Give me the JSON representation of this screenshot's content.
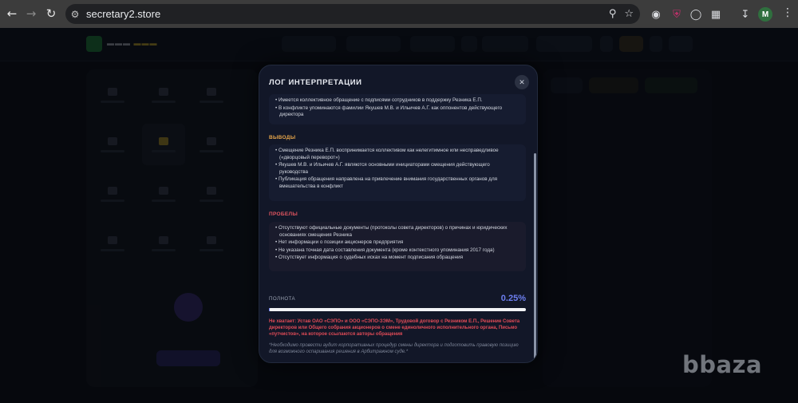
{
  "browser": {
    "url": "secretary2.store",
    "avatar_letter": "M",
    "icons": [
      "back-arrow-icon",
      "forward-arrow-icon",
      "reload-icon",
      "site-settings-icon",
      "zoom-icon",
      "star-icon",
      "incognito-icon",
      "shield-icon",
      "globe-icon",
      "puzzle-icon",
      "download-icon",
      "kebab-menu-icon"
    ]
  },
  "modal": {
    "title": "ЛОГ ИНТЕРПРЕТАЦИИ",
    "facts": [
      "• Имеется коллективное обращение с подписями сотрудников в поддержку Резника Е.П.",
      "• В конфликте упоминаются фамилии Якушев М.В. и Ильичев А.Г. как оппонентов действующего директора"
    ],
    "conclusions": {
      "label": "ВЫВОДЫ",
      "items": [
        "• Смещение Резника Е.П. воспринимается коллективом как нелегитимное или несправедливое («дворцовый переворот»)",
        "• Якушев М.В. и Ильичев А.Г. являются основными инициаторами смещения действующего руководства",
        "• Публикация обращения направлена на привлечение внимания государственных органов для вмешательства в конфликт"
      ]
    },
    "gaps": {
      "label": "ПРОБЕЛЫ",
      "items": [
        "• Отсутствуют официальные документы (протоколы совета директоров) о причинах и юридических основаниях смещения Резника",
        "• Нет информации о позиции акционеров предприятия",
        "• Не указана точная дата составления документа (кроме контекстного упоминания 2017 года)",
        "• Отсутствует информация о судебных исках на момент подписания обращения"
      ]
    },
    "completeness": {
      "label": "ПОЛНОТА",
      "value": "0.25%",
      "fill_percent": 0.25
    },
    "missing": "Не хватает: Устав ОАО «СЭПО» и ООО «СЭПО-ЗЭМ», Трудовой договор с Резником Е.П., Решение Совета директоров или Общего собрания акционеров о смене единоличного исполнительного органа, Письмо «путчистов», на которое ссылаются авторы обращения",
    "note": "*Необходимо провести аудит корпоративных процедур смены директора и подготовить правовую позицию для возможного оспаривания решения в Арбитражном суде.*",
    "close_icon": "close-icon"
  },
  "watermark": "bbaza",
  "colors": {
    "accent_blue": "#6d7ff0",
    "conclusions_orange": "#e6a54a",
    "gaps_red": "#e25560",
    "modal_bg": "#121728"
  }
}
